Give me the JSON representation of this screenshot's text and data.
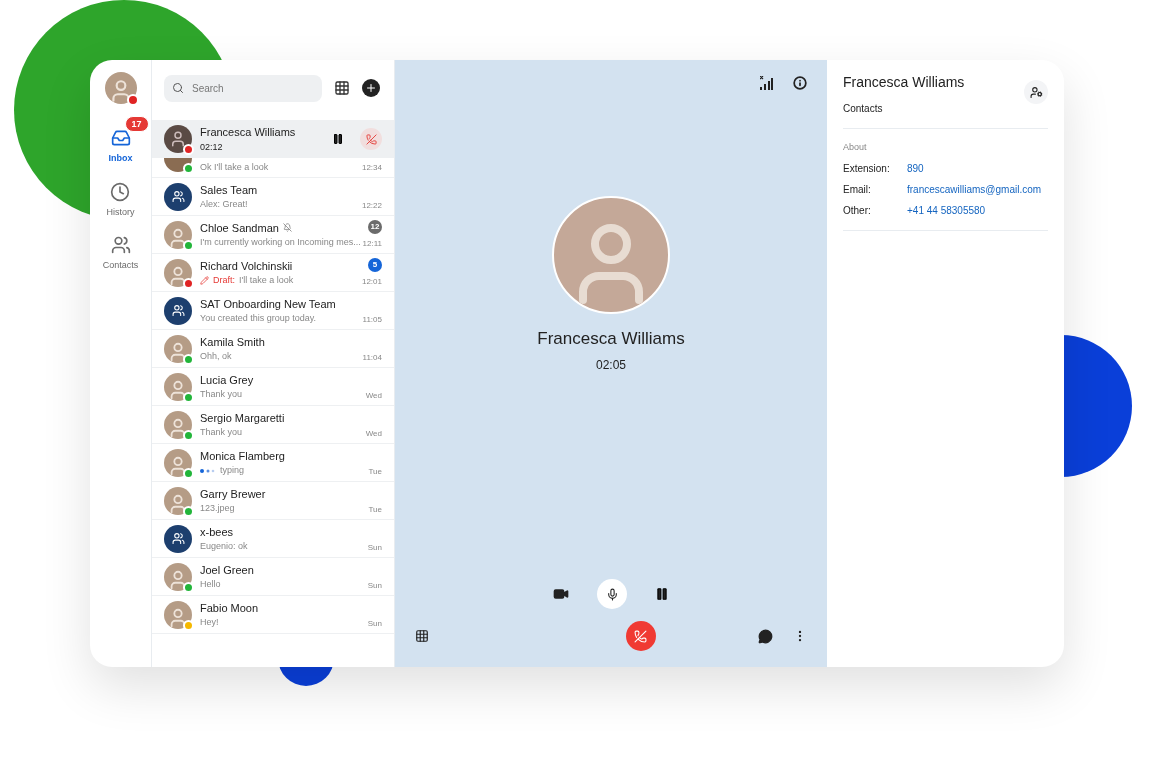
{
  "rail": {
    "color": "#e02424",
    "items": [
      {
        "kind": "inbox",
        "label": "Inbox",
        "selected": true,
        "badge": "17"
      },
      {
        "kind": "history",
        "label": "History",
        "selected": false
      },
      {
        "kind": "contacts",
        "label": "Contacts",
        "selected": false
      }
    ]
  },
  "search": {
    "placeholder": "Search"
  },
  "active_call": {
    "name": "Francesca Williams",
    "duration": "02:12",
    "color": "#e02424"
  },
  "conversations": [
    {
      "kind": "partial",
      "preview": "Ok I'll take a look",
      "time": "12:34",
      "color": "#22b53a"
    },
    {
      "kind": "group",
      "name": "Sales Team",
      "preview": "Alex: Great!",
      "time": "12:22"
    },
    {
      "kind": "person",
      "name": "Chloe Sandman",
      "muted": true,
      "preview": "I'm currently working on Incoming mes...",
      "time": "12:11",
      "color": "#22b53a",
      "badge": "12"
    },
    {
      "kind": "person",
      "name": "Richard Volchinskii",
      "draft": "Draft:",
      "preview": "I'll take a look",
      "time": "12:01",
      "color": "#e02424",
      "badge": "5",
      "muted": false
    },
    {
      "kind": "group",
      "name": "SAT Onboarding New Team",
      "preview": "You created this group today.",
      "time": "11:05"
    },
    {
      "kind": "person",
      "name": "Kamila Smith",
      "preview": "Ohh, ok",
      "time": "11:04",
      "color": "#22b53a"
    },
    {
      "kind": "person",
      "name": "Lucia Grey",
      "preview": "Thank you",
      "time": "Wed",
      "color": "#22b53a"
    },
    {
      "kind": "person",
      "name": "Sergio Margaretti",
      "preview": "Thank you",
      "time": "Wed",
      "color": "#22b53a"
    },
    {
      "kind": "person",
      "name": "Monica Flamberg",
      "typing": true,
      "preview": "typing",
      "time": "Tue",
      "color": "#22b53a"
    },
    {
      "kind": "person",
      "name": "Garry Brewer",
      "preview": "123.jpeg",
      "time": "Tue",
      "color": "#22b53a"
    },
    {
      "kind": "group",
      "name": "x-bees",
      "preview": "Eugenio: ok",
      "time": "Sun"
    },
    {
      "kind": "person",
      "name": "Joel Green",
      "preview": "Hello",
      "time": "Sun",
      "color": "#22b53a"
    },
    {
      "kind": "person",
      "name": "Fabio Moon",
      "preview": "Hey!",
      "time": "Sun",
      "color": "#f5b800"
    }
  ],
  "call": {
    "name": "Francesca Williams",
    "duration": "02:05",
    "mic_on": true
  },
  "info": {
    "name": "Francesca Williams",
    "subtitle": "Contacts",
    "section": "About",
    "fields": [
      {
        "label": "Extension:",
        "value": "890"
      },
      {
        "label": "Email:",
        "value": "francescawilliams@gmail.com"
      },
      {
        "label": "Other:",
        "value": "+41 44 58305580"
      }
    ]
  }
}
